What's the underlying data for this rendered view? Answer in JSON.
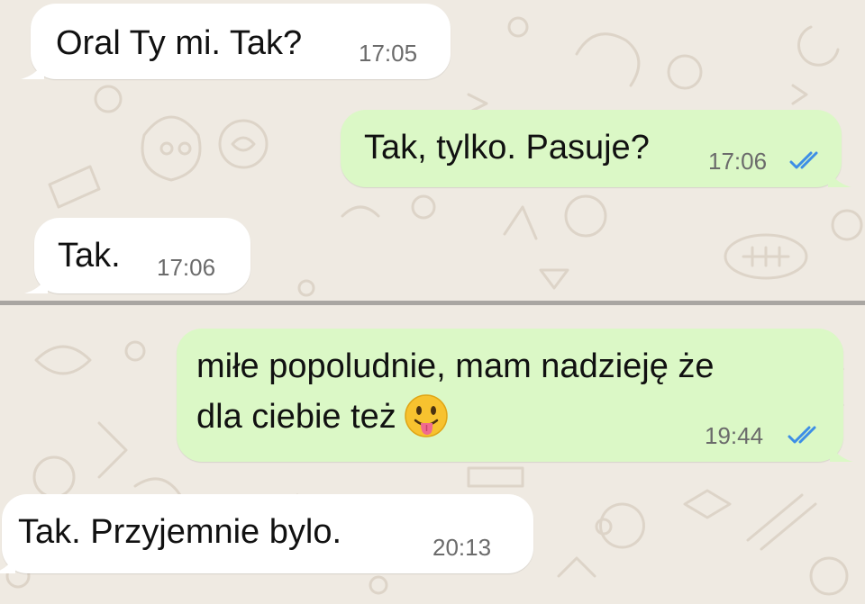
{
  "chat": {
    "messages": [
      {
        "direction": "incoming",
        "text": "Oral Ty mi. Tak?",
        "time": "17:05"
      },
      {
        "direction": "outgoing",
        "text": "Tak, tylko. Pasuje?",
        "time": "17:06",
        "status": "read",
        "status_icon": "double-check-icon"
      },
      {
        "direction": "incoming",
        "text": "Tak.",
        "time": "17:06"
      },
      {
        "direction": "outgoing",
        "text_line1": "miłe popoludnie, mam nadzieję że",
        "text_line2": "dla ciebie też",
        "emoji": "face-with-tongue-emoji",
        "time": "19:44",
        "status": "read",
        "status_icon": "double-check-icon"
      },
      {
        "direction": "incoming",
        "text": "Tak. Przyjemnie bylo.",
        "time": "20:13"
      }
    ]
  },
  "colors": {
    "wallpaper": "#efeae2",
    "incoming_bubble": "#ffffff",
    "outgoing_bubble": "#dbf8c6",
    "read_ticks": "#3d8ee6",
    "time_text": "#6b6b6b"
  }
}
